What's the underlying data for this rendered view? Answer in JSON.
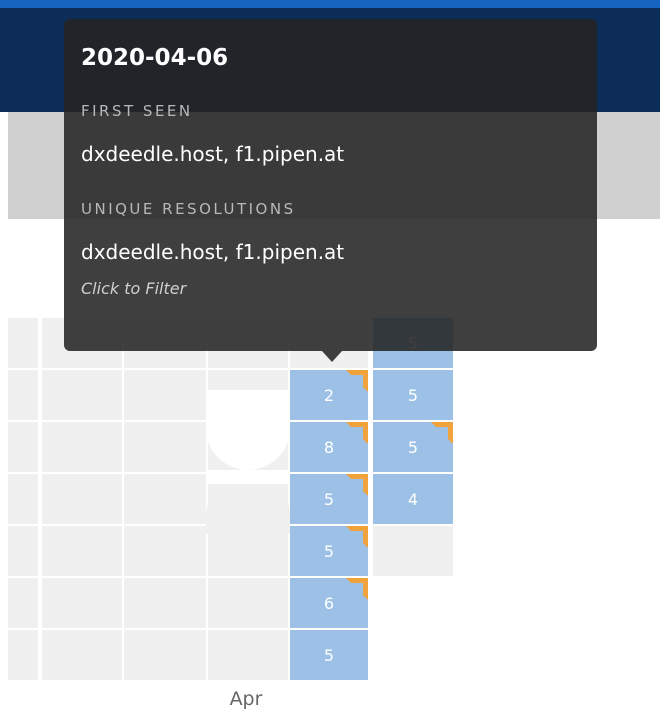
{
  "tooltip": {
    "date": "2020-04-06",
    "first_seen_heading": "FIRST SEEN",
    "first_seen_value": "dxdeedle.host, f1.pipen.at",
    "unique_heading": "UNIQUE RESOLUTIONS",
    "unique_value": "dxdeedle.host, f1.pipen.at",
    "hint": "Click to Filter"
  },
  "calendar": {
    "month_label": "Apr",
    "active_week_1": [
      {
        "value": "2",
        "flag": true
      },
      {
        "value": "8",
        "flag": true
      },
      {
        "value": "5",
        "flag": true
      },
      {
        "value": "5",
        "flag": true
      },
      {
        "value": "6",
        "flag": true
      },
      {
        "value": "5",
        "flag": false
      }
    ],
    "active_week_2": [
      {
        "value": "5",
        "flag": false
      },
      {
        "value": "5",
        "flag": false
      },
      {
        "value": "5",
        "flag": true
      },
      {
        "value": "4",
        "flag": false
      }
    ]
  },
  "colors": {
    "header": "#0c2d57",
    "cell_active": "#9dc1e6",
    "cell_empty": "#f0f0f0",
    "flag": "#f0a33c",
    "tooltip_bg": "#242424"
  }
}
